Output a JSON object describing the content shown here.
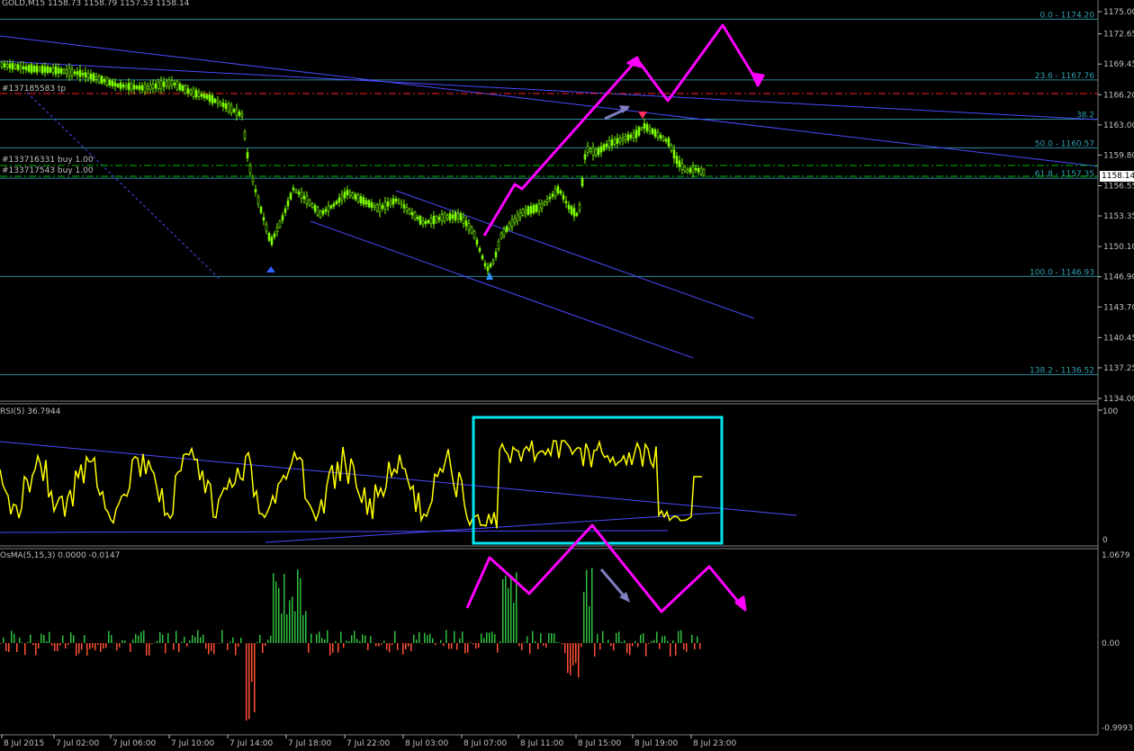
{
  "window": {
    "symbol_header": "GOLD,M15  1158.73 1158.79 1157.53 1158.14"
  },
  "price_axis": {
    "labels": [
      "1175.00",
      "1172.65",
      "1169.45",
      "1166.20",
      "1163.00",
      "1159.80",
      "1156.55",
      "1153.35",
      "1150.10",
      "1146.90",
      "1143.70",
      "1140.45",
      "1137.25",
      "1134.00"
    ],
    "current": "1158.14"
  },
  "fibo": {
    "levels": [
      {
        "label": "0.0 - 1174.20",
        "price": 1174.2
      },
      {
        "label": "23.6 - 1167.76",
        "price": 1167.76
      },
      {
        "label": "38.2",
        "price": 1163.6
      },
      {
        "label": "50.0 - 1160.57",
        "price": 1160.57
      },
      {
        "label": "61.8 - 1157.35",
        "price": 1157.35
      },
      {
        "label": "100.0 - 1146.93",
        "price": 1146.93
      },
      {
        "label": "138.2 - 1136.52",
        "price": 1136.52
      }
    ]
  },
  "orders": {
    "tp_label": "#137185583 tp",
    "buy1_label": "#133716331 buy 1.00",
    "buy2_label": "#133717543 buy 1.00"
  },
  "rsi": {
    "header": "RSI(5) 36.7944",
    "max_label": "100",
    "min_label": "0"
  },
  "osma": {
    "header": "OsMA(5,15,3) 0.0000 -0.0147",
    "top_label": "1.0679",
    "zero_label": "0.00",
    "bottom_label": "-0.9993"
  },
  "time_axis": {
    "labels": [
      "8 Jul 2015",
      "7 Jul 02:00",
      "7 Jul 06:00",
      "7 Jul 10:00",
      "7 Jul 14:00",
      "7 Jul 18:00",
      "7 Jul 22:00",
      "8 Jul 03:00",
      "8 Jul 07:00",
      "8 Jul 11:00",
      "8 Jul 15:00",
      "8 Jul 19:00",
      "8 Jul 23:00"
    ]
  },
  "colors": {
    "background": "#000000",
    "candle": "#7CFC00",
    "grid_text": "#c0c0c0",
    "fibo": "#2f8f9f",
    "trend": "#4040ff",
    "magenta": "#ff00ff",
    "rsi": "#ffff00",
    "highlight_box": "#00e5ee",
    "tp_line": "#ff2020",
    "buy_line": "#00c000",
    "osma_up": "#2fbf3f",
    "osma_down": "#ff5030"
  }
}
